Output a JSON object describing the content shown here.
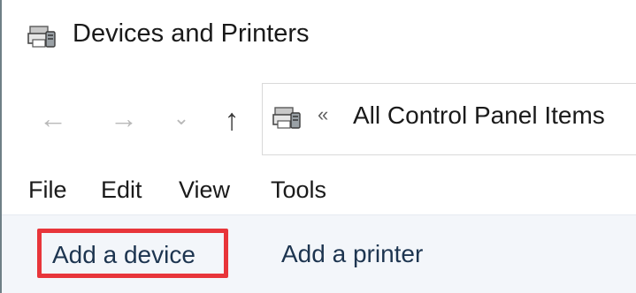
{
  "window": {
    "title": "Devices and Printers",
    "icon": "devices-printers-icon"
  },
  "navigation": {
    "back_icon": "back-arrow-icon",
    "forward_icon": "forward-arrow-icon",
    "recent_icon": "chevron-down-icon",
    "up_icon": "up-arrow-icon",
    "back_glyph": "←",
    "forward_glyph": "→",
    "recent_glyph": "⌄",
    "up_glyph": "↑"
  },
  "address_bar": {
    "icon": "devices-printers-icon",
    "separator": "«",
    "path": "All Control Panel Items"
  },
  "menu": {
    "items": [
      {
        "label": "File"
      },
      {
        "label": "Edit"
      },
      {
        "label": "View"
      },
      {
        "label": "Tools"
      }
    ]
  },
  "command_bar": {
    "add_device": "Add a device",
    "add_printer": "Add a printer"
  },
  "colors": {
    "highlight_border": "#e8353a",
    "command_text": "#1d3550",
    "command_bar_bg": "#f3f6fa"
  }
}
